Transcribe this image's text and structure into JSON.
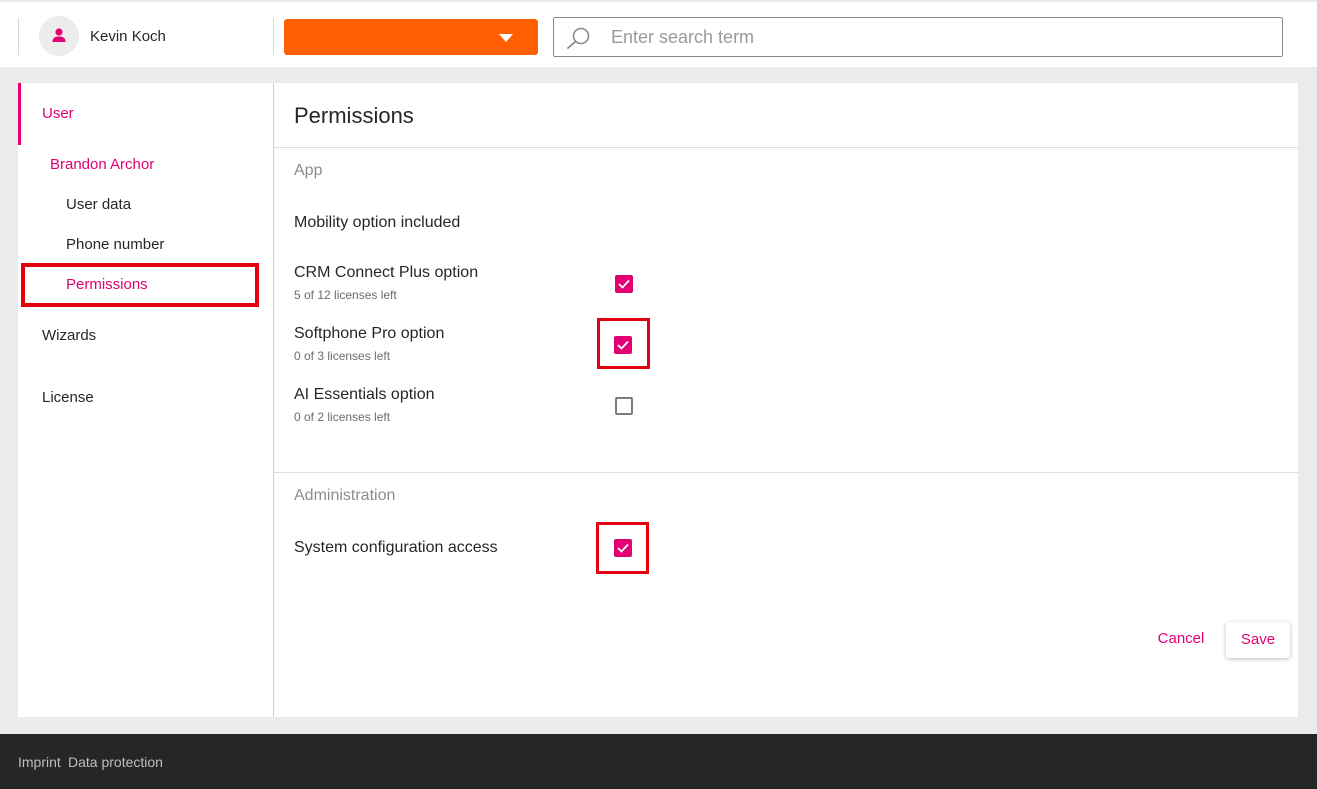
{
  "header": {
    "user_name": "Kevin Koch",
    "avatar_icon": "person-icon",
    "dropdown_value": "",
    "search": {
      "placeholder": "Enter search term",
      "value": "",
      "icon": "search-icon"
    }
  },
  "sidebar": {
    "user": "User",
    "selected_user": "Brandon Archor",
    "sub_items": [
      "User data",
      "Phone number",
      "Permissions"
    ],
    "active_sub_item": "Permissions",
    "wizards": "Wizards",
    "license": "License"
  },
  "main": {
    "title": "Permissions",
    "sections": [
      {
        "title": "App",
        "options": [
          {
            "label": "Mobility option included",
            "sub": "",
            "checkbox": null
          },
          {
            "label": "CRM Connect Plus option",
            "sub": "5 of 12 licenses left",
            "checked": true
          },
          {
            "label": "Softphone Pro option",
            "sub": "0 of 3 licenses left",
            "checked": true
          },
          {
            "label": "AI Essentials option",
            "sub": "0 of 2 licenses left",
            "checked": false
          }
        ]
      },
      {
        "title": "Administration",
        "options": [
          {
            "label": "System configuration access",
            "sub": "",
            "checked": true
          }
        ]
      }
    ],
    "buttons": {
      "cancel": "Cancel",
      "save": "Save"
    }
  },
  "footer": {
    "links": [
      "Imprint",
      "Data protection"
    ]
  },
  "colors": {
    "accent": "#e20074",
    "dropdown": "#ff5f00",
    "highlight": "#e4000f",
    "footer_bg": "#262626"
  }
}
